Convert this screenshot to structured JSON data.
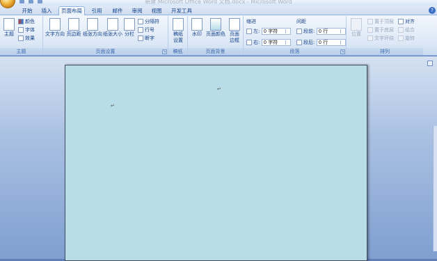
{
  "window": {
    "title": "新建 Microsoft Office Word 文档.docx - Microsoft Word"
  },
  "tabs": [
    {
      "label": "开始"
    },
    {
      "label": "插入"
    },
    {
      "label": "页面布局"
    },
    {
      "label": "引用"
    },
    {
      "label": "邮件"
    },
    {
      "label": "审阅"
    },
    {
      "label": "视图"
    },
    {
      "label": "开发工具"
    }
  ],
  "active_tab": "页面布局",
  "groups": {
    "theme": {
      "label": "主题",
      "theme_button": "主题",
      "colors": "颜色",
      "fonts": "字体",
      "effects": "效果"
    },
    "page_setup": {
      "label": "页面设置",
      "text_direction": "文字方向",
      "margins": "页边距",
      "orientation": "纸张方向",
      "size": "纸张大小",
      "columns": "分栏",
      "breaks": "分隔符",
      "line_numbers": "行号",
      "hyphenation": "断字"
    },
    "draft": {
      "label": "稿纸",
      "draft_settings_1": "稿纸",
      "draft_settings_2": "设置"
    },
    "page_background": {
      "label": "页面背景",
      "watermark": "水印",
      "page_color": "页面颜色",
      "page_borders_1": "页面",
      "page_borders_2": "边框"
    },
    "paragraph": {
      "label": "段落",
      "indent_header": "缩进",
      "spacing_header": "间距",
      "indent_left_label": "左:",
      "indent_left_value": "0 字符",
      "indent_right_label": "右:",
      "indent_right_value": "0 字符",
      "spacing_before_label": "段前:",
      "spacing_before_value": "0 行",
      "spacing_after_label": "段后:",
      "spacing_after_value": "0 行"
    },
    "arrange": {
      "label": "排列",
      "position": "位置",
      "bring_front": "置于顶层",
      "send_back": "置于底层",
      "text_wrap": "文字环绕",
      "align": "对齐",
      "group": "组合",
      "rotate": "旋转"
    }
  },
  "document": {
    "paragraph_mark": "↵"
  },
  "colors": {
    "page_background": "#b8dde8",
    "ribbon": "#dce8f6",
    "workspace": "#a9c0e2"
  }
}
